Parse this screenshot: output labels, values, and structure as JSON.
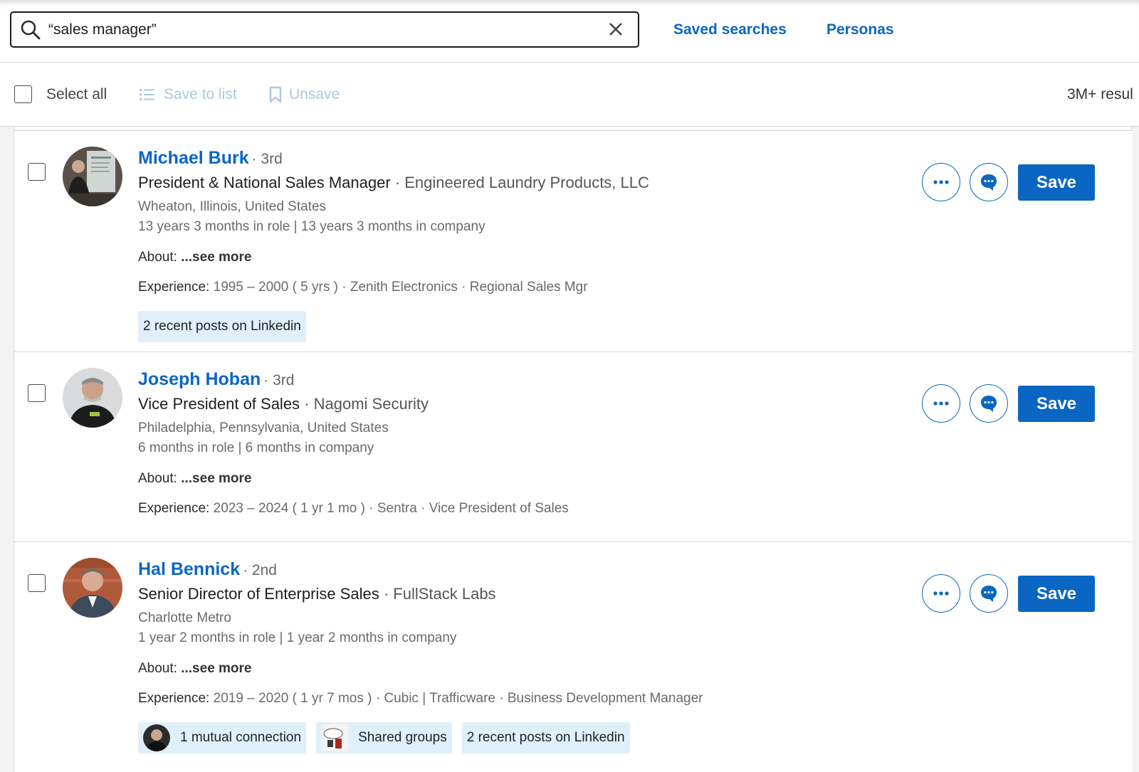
{
  "search": {
    "value": "“sales manager”"
  },
  "top_links": {
    "saved_searches": "Saved searches",
    "personas": "Personas"
  },
  "actions": {
    "select_all": "Select all",
    "save_to_list": "Save to list",
    "unsave": "Unsave",
    "results_count": "3M+ resul"
  },
  "colors": {
    "brand": "#0a66c2",
    "chip_bg": "#dff0fb",
    "disabled": "#a9c7e4"
  },
  "results": [
    {
      "name": "Michael Burk",
      "degree": "· 3rd",
      "title": "President & National Sales Manager",
      "company": "· Engineered Laundry Products, LLC",
      "location": "Wheaton, Illinois, United States",
      "tenure": "13 years 3 months in role | 13 years 3 months in company",
      "about_label": "About:",
      "about_link": "...see more",
      "experience_label": "Experience:",
      "experience": "1995 – 2000  ( 5 yrs ) · Zenith Electronics · Regional Sales Mgr",
      "chips": [
        "2 recent posts on Linkedin"
      ],
      "save_label": "Save"
    },
    {
      "name": "Joseph Hoban",
      "degree": "· 3rd",
      "title": "Vice President of Sales",
      "company": "· Nagomi Security",
      "location": "Philadelphia, Pennsylvania, United States",
      "tenure": "6 months in role | 6 months in company",
      "about_label": "About:",
      "about_link": "...see more",
      "experience_label": "Experience:",
      "experience": "2023 – 2024  ( 1 yr 1 mo ) · Sentra · Vice President of Sales",
      "chips": [],
      "save_label": "Save"
    },
    {
      "name": "Hal Bennick",
      "degree": "· 2nd",
      "title": "Senior Director of Enterprise Sales",
      "company": "· FullStack Labs",
      "location": "Charlotte Metro",
      "tenure": "1 year 2 months in role | 1 year 2 months in company",
      "about_label": "About:",
      "about_link": "...see more",
      "experience_label": "Experience:",
      "experience": "2019 – 2020  ( 1 yr 7 mos ) · Cubic | Trafficware · Business Development Manager",
      "chips": [
        "1 mutual connection",
        "Shared groups",
        "2 recent posts on Linkedin"
      ],
      "save_label": "Save"
    }
  ]
}
